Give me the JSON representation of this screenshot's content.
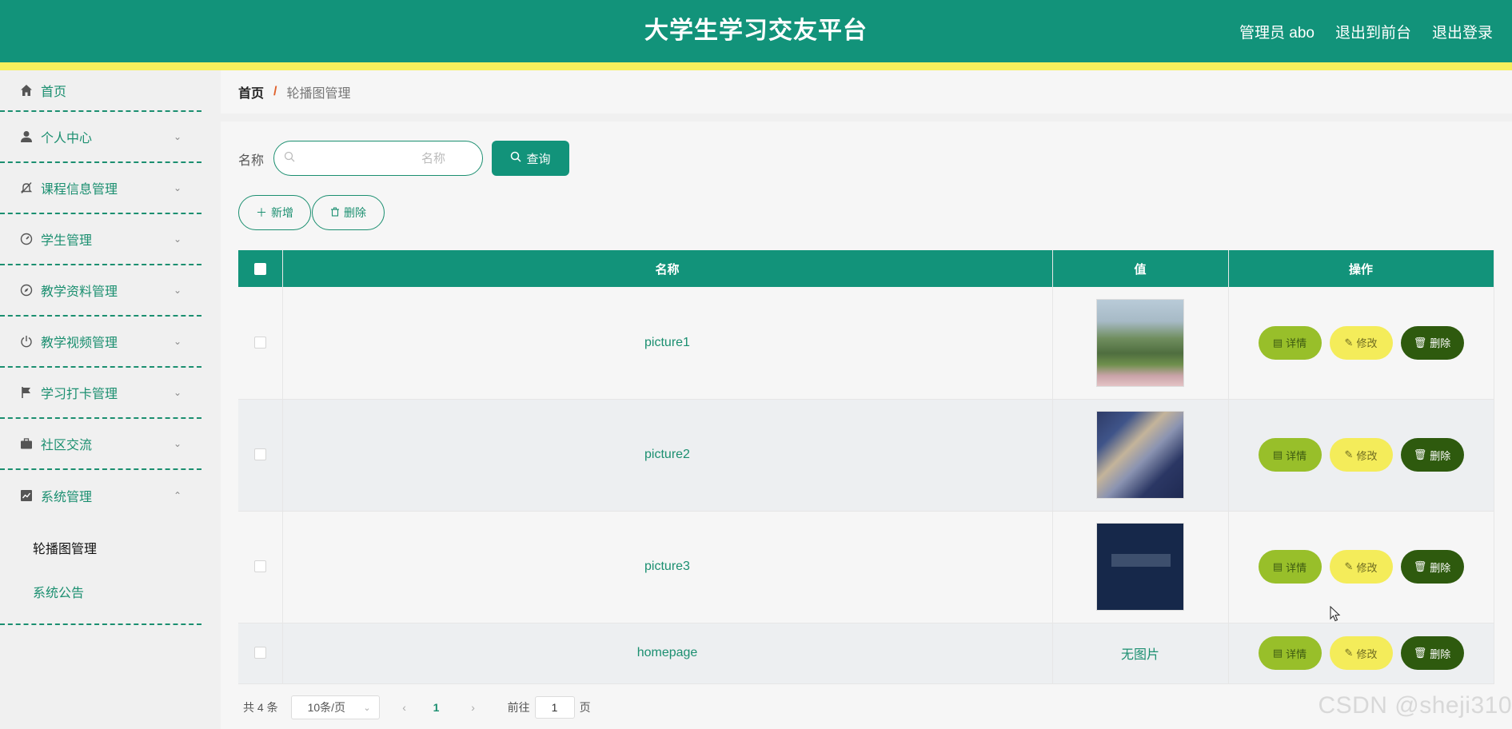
{
  "header": {
    "title": "大学生学习交友平台",
    "user_label": "管理员 abo",
    "back_to_front": "退出到前台",
    "logout": "退出登录"
  },
  "sidebar": {
    "items": [
      {
        "label": "首页",
        "icon": "home-icon"
      },
      {
        "label": "个人中心",
        "icon": "user-icon"
      },
      {
        "label": "课程信息管理",
        "icon": "bell-off-icon"
      },
      {
        "label": "学生管理",
        "icon": "gauge-icon"
      },
      {
        "label": "教学资料管理",
        "icon": "compass-icon"
      },
      {
        "label": "教学视频管理",
        "icon": "power-icon"
      },
      {
        "label": "学习打卡管理",
        "icon": "flag-icon"
      },
      {
        "label": "社区交流",
        "icon": "briefcase-icon"
      },
      {
        "label": "系统管理",
        "icon": "chart-icon"
      }
    ],
    "subitems": [
      {
        "label": "轮播图管理"
      },
      {
        "label": "系统公告"
      }
    ]
  },
  "breadcrumb": {
    "home": "首页",
    "separator": "/",
    "current": "轮播图管理"
  },
  "search": {
    "label": "名称",
    "placeholder": "名称",
    "value": "",
    "button": "查询"
  },
  "actions": {
    "add": "新增",
    "delete": "删除"
  },
  "table": {
    "columns": [
      "名称",
      "值",
      "操作"
    ],
    "rows": [
      {
        "name": "picture1",
        "value": "",
        "has_image": true
      },
      {
        "name": "picture2",
        "value": "",
        "has_image": true
      },
      {
        "name": "picture3",
        "value": "",
        "has_image": true
      },
      {
        "name": "homepage",
        "value": "无图片",
        "has_image": false
      }
    ],
    "row_actions": {
      "detail": "详情",
      "edit": "修改",
      "delete": "删除"
    }
  },
  "pagination": {
    "total": "共 4 条",
    "page_size": "10条/页",
    "current_page": "1",
    "goto_label": "前往",
    "goto_value": "1",
    "page_suffix": "页"
  },
  "watermark": "CSDN @sheji310",
  "colors": {
    "primary": "#12937a",
    "stripe": "#f7ef5c",
    "detail_btn": "#98bf2a",
    "edit_btn": "#f4ec5a",
    "delete_btn": "#2e5a0e"
  }
}
